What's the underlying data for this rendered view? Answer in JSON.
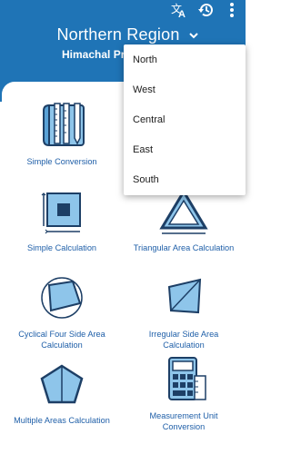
{
  "app_bar": {
    "region_title": "Northern Region",
    "subtitle": "Himachal Pr",
    "icons": [
      "translate-icon",
      "history-icon",
      "more-vert-icon"
    ],
    "background": "#1f74b6"
  },
  "calculators": [
    {
      "label": "Simple Conversion",
      "icon": "rulers-icon"
    },
    {
      "label": "Simple Calculation",
      "icon": "square-icon"
    },
    {
      "label": "Triangular Area Calculation",
      "icon": "triangle-icon"
    },
    {
      "label": "Cyclical Four Side Area Calculation",
      "icon": "cyclic-quad-icon"
    },
    {
      "label": "Irregular Side Area Calculation",
      "icon": "irregular-quad-icon"
    },
    {
      "label": "Multiple Areas Calculation",
      "icon": "pentagon-icon"
    },
    {
      "label": "Measurement Unit Conversion",
      "icon": "calculator-icon"
    }
  ],
  "region_menu": {
    "options": [
      "North",
      "West",
      "Central",
      "East",
      "South"
    ]
  },
  "colors": {
    "accent": "#1f5fa8",
    "icon_fill": "#8ec5ea",
    "icon_dark": "#1d3f66"
  }
}
